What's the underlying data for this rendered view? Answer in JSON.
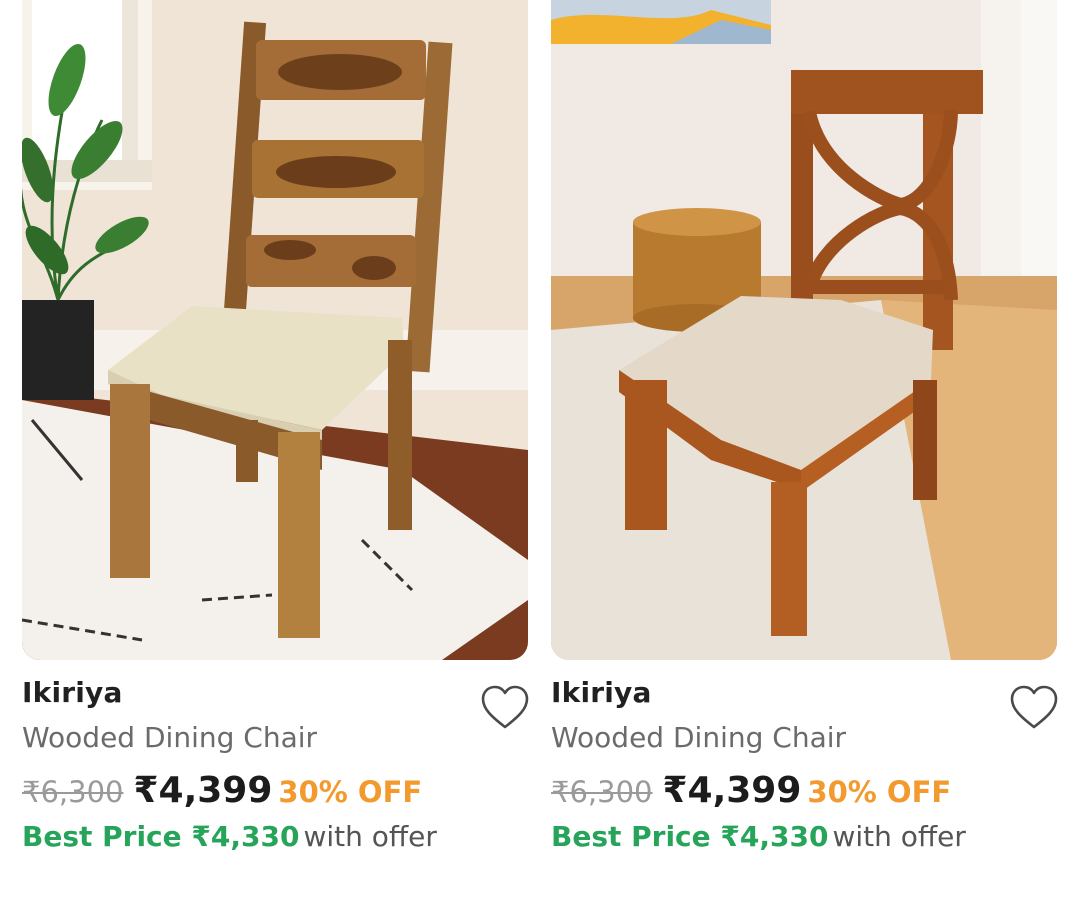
{
  "products": [
    {
      "brand": "Ikiriya",
      "title": "Wooded Dining Chair",
      "mrp": "₹6,300",
      "price": "₹4,399",
      "discount": "30% OFF",
      "best_price": "Best Price ₹4,330",
      "offer_suffix": "with offer",
      "wishlist_icon": "heart-outline-icon"
    },
    {
      "brand": "Ikiriya",
      "title": "Wooded Dining Chair",
      "mrp": "₹6,300",
      "price": "₹4,399",
      "discount": "30% OFF",
      "best_price": "Best Price ₹4,330",
      "offer_suffix": "with offer",
      "wishlist_icon": "heart-outline-icon"
    }
  ],
  "colors": {
    "discount": "#f29a2e",
    "best_price": "#26a55a",
    "mrp_strike": "#9a9a9a"
  }
}
